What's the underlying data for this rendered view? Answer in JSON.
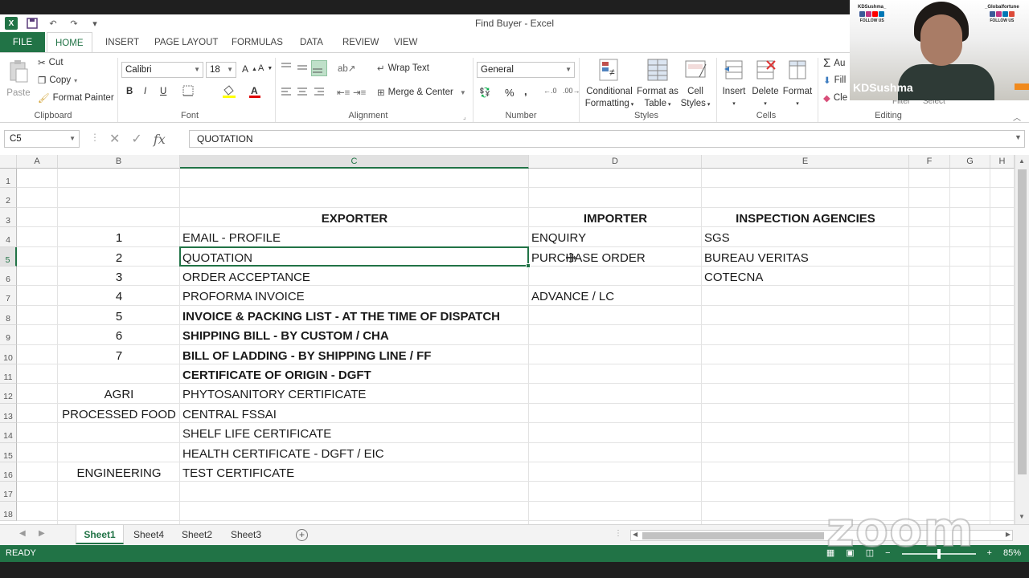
{
  "window": {
    "title": "Find Buyer - Excel"
  },
  "ribbon": {
    "tabs": [
      "FILE",
      "HOME",
      "INSERT",
      "PAGE LAYOUT",
      "FORMULAS",
      "DATA",
      "REVIEW",
      "VIEW"
    ],
    "active_tab": "HOME",
    "clipboard": {
      "paste": "Paste",
      "cut": "Cut",
      "copy": "Copy",
      "format_painter": "Format Painter",
      "label": "Clipboard"
    },
    "font": {
      "name": "Calibri",
      "size": "18",
      "bold": "B",
      "italic": "I",
      "underline": "U",
      "label": "Font"
    },
    "alignment": {
      "wrap_text": "Wrap Text",
      "merge_center": "Merge & Center",
      "label": "Alignment"
    },
    "number": {
      "format": "General",
      "percent": "%",
      "comma": ",",
      "label": "Number"
    },
    "styles": {
      "conditional_formatting_1": "Conditional",
      "conditional_formatting_2": "Formatting",
      "format_as_table_1": "Format as",
      "format_as_table_2": "Table",
      "cell_styles_1": "Cell",
      "cell_styles_2": "Styles",
      "label": "Styles"
    },
    "cells": {
      "insert": "Insert",
      "delete": "Delete",
      "format": "Format",
      "label": "Cells"
    },
    "editing": {
      "autosum": "Au",
      "fill": "Fill",
      "clear": "Cle",
      "sort_filter": "Filter",
      "find_select": "Select",
      "label": "Editing"
    }
  },
  "formula_bar": {
    "name_box": "C5",
    "content": "QUOTATION"
  },
  "grid": {
    "columns": [
      "A",
      "B",
      "C",
      "D",
      "E",
      "F",
      "G",
      "H"
    ],
    "selected_column": "C",
    "rows": [
      "1",
      "2",
      "3",
      "4",
      "5",
      "6",
      "7",
      "8",
      "9",
      "10",
      "11",
      "12",
      "13",
      "14",
      "15",
      "16",
      "17",
      "18"
    ],
    "selected_row": "5",
    "cells": {
      "C3": "EXPORTER",
      "D3": "IMPORTER",
      "E3": "INSPECTION AGENCIES",
      "B4": "1",
      "C4": "EMAIL  - PROFILE",
      "D4": "ENQUIRY",
      "E4": "SGS",
      "B5": "2",
      "C5": "QUOTATION",
      "D5": "PURCHASE ORDER",
      "E5": "BUREAU VERITAS",
      "B6": "3",
      "C6": "ORDER ACCEPTANCE",
      "E6": "COTECNA",
      "B7": "4",
      "C7": "PROFORMA INVOICE",
      "D7": "ADVANCE / LC",
      "B8": "5",
      "C8": "INVOICE & PACKING LIST - AT THE TIME OF DISPATCH",
      "B9": "6",
      "C9": "SHIPPING BILL - BY CUSTOM / CHA",
      "B10": "7",
      "C10": "BILL OF LADDING - BY SHIPPING LINE / FF",
      "C11": "CERTIFICATE OF ORIGIN - DGFT",
      "B12": "AGRI",
      "C12": "PHYTOSANITORY CERTIFICATE",
      "B13": "PROCESSED FOOD",
      "C13": "CENTRAL FSSAI",
      "C14": "SHELF LIFE CERTIFICATE",
      "C15": "HEALTH CERTIFICATE - DGFT / EIC",
      "B16": "ENGINEERING",
      "C16": "TEST CERTIFICATE"
    }
  },
  "sheets": {
    "tabs": [
      "Sheet1",
      "Sheet4",
      "Sheet2",
      "Sheet3"
    ],
    "active": "Sheet1"
  },
  "status": {
    "ready": "READY",
    "zoom": "85%"
  },
  "overlay": {
    "presenter_name": "KDSushma",
    "brand_left": "KDSushma_",
    "brand_right": "_Globalfortune",
    "follow_left": "FOLLOW US",
    "follow_right": "FOLLOW US",
    "watermark": "zoom"
  },
  "colors": {
    "excel_green": "#217346",
    "grid_line": "#e3e3e3"
  }
}
